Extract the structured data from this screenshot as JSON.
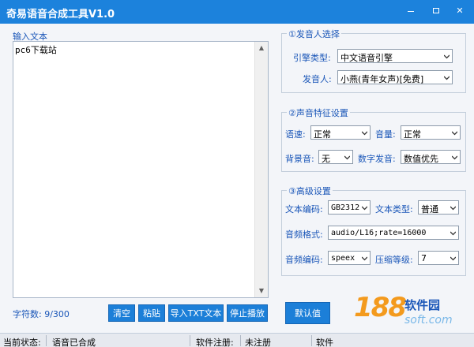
{
  "window": {
    "title": "奇易语音合成工具V1.0",
    "close_glyph": "✕"
  },
  "input": {
    "label": "输入文本",
    "text": "pc6下载站",
    "char_count": "字符数: 9/300"
  },
  "buttons": {
    "clear": "清空",
    "paste": "粘贴",
    "import": "导入TXT文本",
    "stop": "停止播放",
    "default": "默认值"
  },
  "speaker": {
    "title": "①发音人选择",
    "engine_label": "引擎类型:",
    "engine_value": "中文语音引擎",
    "voice_label": "发音人:",
    "voice_value": "小燕(青年女声)[免费]"
  },
  "voice_features": {
    "title": "②声音特征设置",
    "speed_label": "语速:",
    "speed_value": "正常",
    "volume_label": "音量:",
    "volume_value": "正常",
    "bg_label": "背景音:",
    "bg_value": "无",
    "digit_label": "数字发音:",
    "digit_value": "数值优先"
  },
  "advanced": {
    "title": "③高级设置",
    "encoding_label": "文本编码:",
    "encoding_value": "GB2312",
    "text_type_label": "文本类型:",
    "text_type_value": "普通",
    "audio_format_label": "音频格式:",
    "audio_format_value": "audio/L16;rate=16000",
    "audio_codec_label": "音频编码:",
    "audio_codec_value": "speex",
    "compress_label": "压缩等级:",
    "compress_value": "7"
  },
  "status": {
    "state_label": "当前状态:",
    "state_value": "语音已合成",
    "reg_label": "软件注册:",
    "reg_value": "未注册",
    "extra_label": "软件"
  },
  "watermark": {
    "number": "188",
    "name": "软件园",
    "domain": "soft.com"
  },
  "colors": {
    "title_bar": "#1c82dc",
    "button": "#1c7fd8",
    "label_text": "#1a56b8",
    "watermark_orange": "#f39a1e"
  },
  "icons": {
    "minimize": "minimize-icon",
    "maximize": "maximize-icon",
    "close": "close-icon",
    "dropdown": "chevron-down-icon"
  }
}
